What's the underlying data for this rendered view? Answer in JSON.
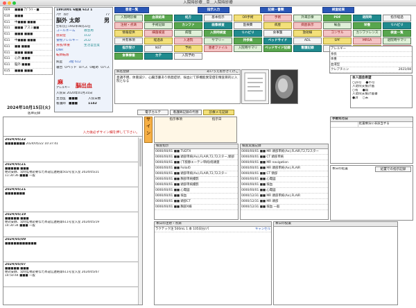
{
  "window": {
    "title": "入院時診療＿幸＿入院時診療"
  },
  "patient_list": {
    "rows": [
      {
        "room": "609",
        "name": "■■■ ｱﾌﾞﾗｲﾄ・■"
      },
      {
        "room": "610",
        "name": "■■■"
      },
      {
        "room": "611",
        "name": "中■■■ ■■■"
      },
      {
        "room": "611",
        "name": "■■■ アスミ■■"
      },
      {
        "room": "611",
        "name": "■■■ ■■■"
      },
      {
        "room": "611",
        "name": "中■■■ ■■■"
      },
      {
        "room": "611",
        "name": "■■ ■■■"
      },
      {
        "room": "611",
        "name": "■■■ ■■■"
      },
      {
        "room": "611",
        "name": "心外 ■■■"
      },
      {
        "room": "611",
        "name": "脳外 ■■■"
      },
      {
        "room": "615",
        "name": "■■■ ■■■"
      }
    ]
  },
  "patient_card": {
    "id_line": "1891001 6階東 612 1",
    "kana": "ﾉｳｹﾞ ﾀﾛｳ",
    "age": "77",
    "name": "脳外 太郎",
    "sex": "男",
    "dob": "生年月日 1942年08月22日",
    "labels": [
      "コールネーム",
      "感染症",
      "食物アレルギー",
      "身長/体重",
      "DNR",
      "転倒転落"
    ],
    "value_labels": [
      "救急用",
      "1CD",
      "2CD",
      "生活自立度"
    ],
    "ward_label": "病室",
    "ward_value": "3階 612",
    "mobility": [
      "寝台",
      "Oベッド",
      "Oバス",
      "O軽め",
      "Oバス"
    ],
    "allergy": "麻",
    "allergy_label": "アレルギー",
    "diagnosis": "脳出血",
    "admission_date": "入院日 2020年01月31日",
    "attending_label": "主治医",
    "attending_value": "■■■",
    "days_label": "入院日数",
    "days_value": "1142",
    "nurse_label": "看護師",
    "nurse_value": "■■■"
  },
  "date_line": "2024年10月15日(火)",
  "record_section_label": "医師記録",
  "toolbar": {
    "groups": [
      {
        "label": "患者一覧"
      },
      {
        "label": "指示入力"
      },
      {
        "label": "記録・書類"
      },
      {
        "label": "検査結果"
      }
    ],
    "buttons": [
      {
        "label": "入院時診療"
      },
      {
        "label": "血液結果"
      },
      {
        "label": "処方"
      },
      {
        "label": "基本指示"
      },
      {
        "label": "OR手術"
      },
      {
        "label": "手術"
      },
      {
        "label": "外来診療"
      },
      {
        "label": "PDF"
      },
      {
        "label": "退院時"
      },
      {
        "label": "指示経過"
      },
      {
        "label": "注射・点滴"
      },
      {
        "label": "手術記録"
      },
      {
        "label": "カンファ"
      },
      {
        "label": "画像検査"
      },
      {
        "label": "医療費"
      },
      {
        "label": "病歴"
      },
      {
        "label": "病歴表示"
      },
      {
        "label": "輸血"
      },
      {
        "label": "栄養"
      },
      {
        "label": "リハビリ"
      },
      {
        "label": "情報提供"
      },
      {
        "label": "細菌検査"
      },
      {
        "label": "病理"
      },
      {
        "label": "入院時検査"
      },
      {
        "label": "リハビリ"
      },
      {
        "label": "食事箋"
      },
      {
        "label": "放射線"
      },
      {
        "label": "コンサル"
      },
      {
        "label": "カンファレンス"
      },
      {
        "label": "検査一覧"
      },
      {
        "label": "共有事項"
      },
      {
        "label": "経過表"
      },
      {
        "label": "入退院"
      },
      {
        "label": "サマリー"
      },
      {
        "label": "持参薬"
      },
      {
        "label": "ベッドサイド"
      },
      {
        "label": "ADL"
      },
      {
        "label": "SPF"
      },
      {
        "label": "MRSA"
      },
      {
        "label": "退院時サマリ"
      },
      {
        "label": "指示受け"
      },
      {
        "label": "NST"
      },
      {
        "label": "予約"
      },
      {
        "label": "患者ファイル"
      },
      {
        "label": "入院時サマリ"
      },
      {
        "label": "ベッドサイド記録"
      },
      {
        "label": "看護記録"
      },
      {
        "label": "病名"
      },
      {
        "label": "AI検索"
      },
      {
        "label": "ケア"
      },
      {
        "label": "食事療養"
      },
      {
        "label": "カテ"
      },
      {
        "label": "入院予約"
      }
    ]
  },
  "problem_box": {
    "title": "病名登録",
    "subtitle": "あいうえおかきくけこ",
    "text": "意識不明、体重減少、心臓浮腫あり熱発症状、採血にて肝機能異常値を精査目的に入院となる"
  },
  "side_panel": {
    "rows": [
      {
        "label": "アレルギー",
        "value": ""
      },
      {
        "label": "身長",
        "value": ""
      },
      {
        "label": "体重",
        "value": ""
      },
      {
        "label": "血液型",
        "value": ""
      },
      {
        "label": "クレアチニン",
        "value": "2021/08"
      }
    ]
  },
  "right_options": {
    "title": "本人面会希望",
    "opts1": [
      "○許可",
      "●不可"
    ],
    "q2": "入退院支援計画",
    "opts2": [
      "○有",
      "●無"
    ],
    "q3": "入退院支援計画書",
    "opts3": [
      "●済",
      "○未"
    ]
  },
  "mid_buttons": [
    {
      "label": "電子カルテ"
    },
    {
      "label": "看護師記録の代替"
    },
    {
      "label": "診療メモ記録"
    }
  ],
  "entry_prompt": "入力後必ずサイン欄を押して下さい。",
  "records": [
    {
      "date": "2024/05/22",
      "lines": [
        "■■■■■■■ 2024/05/22 10:37:41"
      ]
    },
    {
      "date": "2024/05/21",
      "lines": [
        "■■■■■ ■■■",
        "絶対安静、常時監視必要なため返信連絡第502号室入室 2024/05/21",
        "11:30:36 ■■■ 一般"
      ]
    },
    {
      "date": "2024/05/21",
      "lines": [
        "■■■■■■■"
      ]
    },
    {
      "date": "2024/05/19",
      "lines": [
        "■■■■■ ■■■",
        "絶対安静、常時監視必要なため返信連絡第611号室入室 2024/05/19",
        "14:30:34 ■■■ 一般"
      ]
    },
    {
      "date": "2024/05/09",
      "lines": [
        "■■■■■■■■■■■"
      ]
    },
    {
      "date": "2024/05/07",
      "lines": [
        "■■■■■ ■■■",
        "絶対安静、常時監視必要なため返信連絡第611号室入室 2024/05/07",
        "14:50:44 ■■■ 一般"
      ]
    }
  ],
  "orange_panel": {
    "chars": [
      "サ",
      "イ",
      "ン"
    ],
    "fields": [
      "指示事項",
      "指示日"
    ]
  },
  "order_table": {
    "title": "検査指示",
    "rows": [
      "0000/00/01 ■■ TUDTX",
      "0000/00/01 ■■ 頭部単純(Ax),FLAIR,T2,T2スター,頸部",
      "0000/00/01 ■■ (下肢静エーテン単純)経頭蓋",
      "0000/00/01 ■■ Foliaの",
      "0000/00/01 ■■ 頭部単純(Ax),FLAIR,T2,T2スター",
      "0000/00/01 ■■ 胸部単純撮影",
      "0000/00/01 ■■ 頭部単純撮影",
      "0000/00/01 ■■ 心電図",
      "0000/00/01 ■■ 採血",
      "0000/00/01 ■■ 頭部CT",
      "0000/00/01 ■■ 胸部X線"
    ]
  },
  "results_table": {
    "title": "検査実施記録",
    "rows": [
      "0000/00/01 ■■ MR 頭部単純(Ax),FLAIR,T2,T2スター",
      "0000/00/01 ■■ CT 頭部単純",
      "0000/00/01 ■■ MR navigation",
      "0000/00/01 ■■ MR 頭部単純(Ax),FLAIR",
      "0000/00/01 ■■ CT 頸部",
      "0000/00/01 ■■ 心電図",
      "0000/00/01 ■■ 採血",
      "0000/00/01 ■■ 心電図",
      "0000/12/31 ■■ MR 頭部単純(Ax),FLAIR",
      "0000/12/31 ■■ MR 頭部",
      "0000/12/31 ■■ 採血 一般"
    ]
  },
  "injection_panel": {
    "title": "本日の注射・点滴",
    "row": "ラクテック注 500mL 1 本 105日分/パ",
    "cancel": "キャンセル"
  },
  "meds_panel": {
    "title": "本日の投薬"
  },
  "surgery_panel": {
    "title": "手術年月日",
    "col1": "",
    "col2": "処置療法に非該当する"
  },
  "today_section": {
    "title": "本日の処置",
    "button": "処置での指示記録"
  },
  "colors": {
    "accent_blue": "#2a57b8",
    "accent_green": "#58a64e",
    "accent_teal": "#1f8a8e",
    "alert_red": "#d21a1a",
    "panel_orange": "#f6b046"
  }
}
